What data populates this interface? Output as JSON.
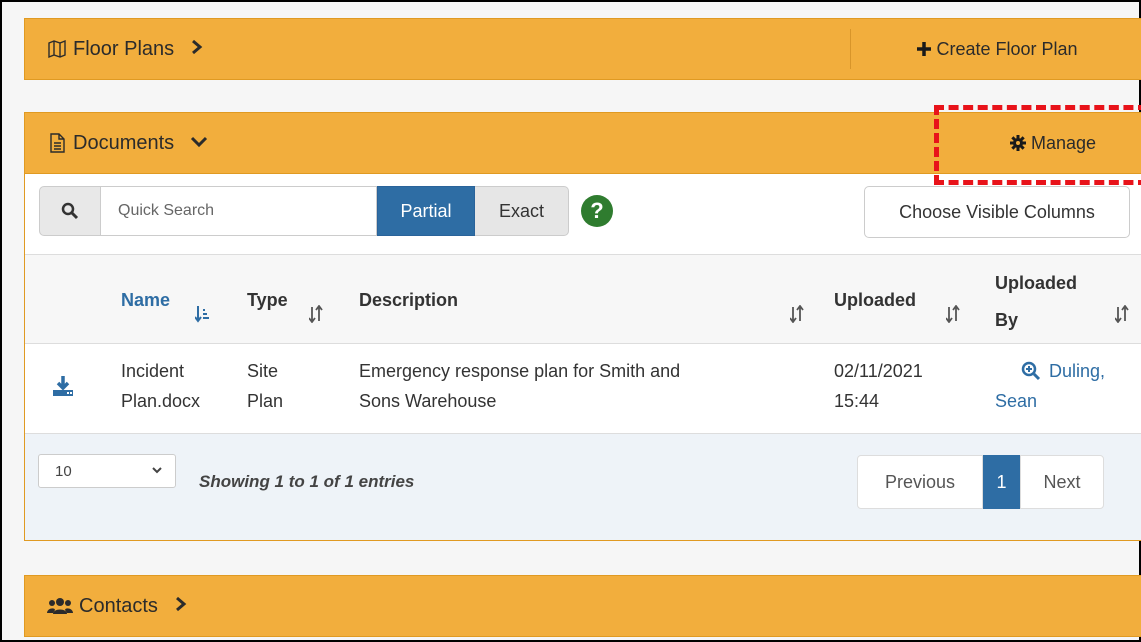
{
  "floor_plans": {
    "title": "Floor Plans",
    "create_label": "Create Floor Plan"
  },
  "documents": {
    "title": "Documents",
    "manage_label": "Manage",
    "search": {
      "placeholder": "Quick Search",
      "value": ""
    },
    "match_modes": {
      "partial": "Partial",
      "exact": "Exact",
      "active": "Partial"
    },
    "help": "?",
    "choose_columns_label": "Choose Visible Columns",
    "columns": {
      "name": "Name",
      "type": "Type",
      "description": "Description",
      "uploaded": "Uploaded",
      "uploaded_by_1": "Uploaded",
      "uploaded_by_2": "By"
    },
    "rows": [
      {
        "name_1": "Incident",
        "name_2": "Plan.docx",
        "type_1": "Site",
        "type_2": "Plan",
        "description_1": "Emergency response plan for Smith and",
        "description_2": "Sons Warehouse",
        "date": "02/11/2021",
        "time": "15:44",
        "uploader_1": "Duling,",
        "uploader_2": "Sean"
      }
    ],
    "page_length": "10",
    "info": "Showing 1 to 1 of 1 entries",
    "pagination": {
      "previous": "Previous",
      "current": "1",
      "next": "Next"
    }
  },
  "contacts": {
    "title": "Contacts"
  },
  "colors": {
    "bar": "#f2ae3d",
    "primary": "#2e6da4",
    "help": "#2f7c2f",
    "highlight": "#e8131a"
  }
}
